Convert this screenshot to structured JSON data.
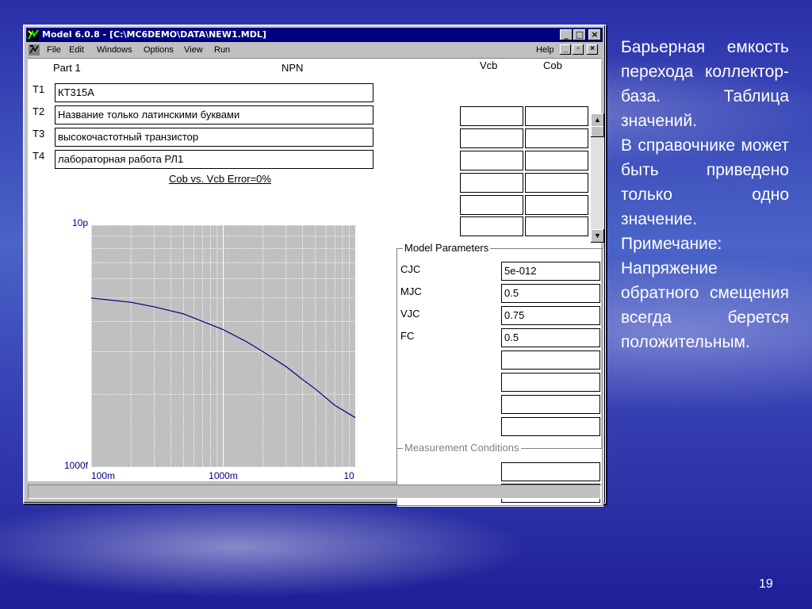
{
  "window": {
    "title": "Model 6.0.8 - [C:\\MC6DEMO\\DATA\\NEW1.MDL]",
    "min_label": "_",
    "max_label": "□",
    "close_label": "×"
  },
  "menu": {
    "items": [
      "File",
      "Edit",
      "Windows",
      "Options",
      "View",
      "Run"
    ],
    "help": "Help"
  },
  "header": {
    "part_label": "Part 1",
    "type_label": "NPN",
    "vcb_header": "Vcb",
    "cob_header": "Cob"
  },
  "texts": [
    {
      "label": "T1",
      "value": "КТ315А"
    },
    {
      "label": "T2",
      "value": "Название только латинскими буквами"
    },
    {
      "label": "T3",
      "value": "высокочастотный транзистор"
    },
    {
      "label": "T4",
      "value": "лабораторная работа РЛ1"
    }
  ],
  "graph_title": "Cob vs. Vcb Error=0%",
  "chart_data": {
    "type": "line",
    "title": "Cob vs. Vcb Error=0%",
    "xscale": "log",
    "yscale": "log",
    "xlim": [
      0.1,
      10
    ],
    "ylim": [
      1e-12,
      1e-11
    ],
    "x_ticks": [
      "100m",
      "1000m",
      "10"
    ],
    "y_ticks": [
      "10p",
      "1000f"
    ],
    "series": [
      {
        "x": [
          0.1,
          0.2,
          0.3,
          0.5,
          0.7,
          1.0,
          1.5,
          2.0,
          3.0,
          4.0,
          5.0,
          7.0,
          10.0
        ],
        "y": [
          5e-12,
          4.8e-12,
          4.6e-12,
          4.3e-12,
          4e-12,
          3.7e-12,
          3.3e-12,
          3e-12,
          2.6e-12,
          2.3e-12,
          2.1e-12,
          1.8e-12,
          1.6e-12
        ]
      }
    ],
    "grid": true,
    "line_color": "#000080",
    "plot_background": "#c0c0c0"
  },
  "model_parameters": {
    "legend": "Model Parameters",
    "params": [
      {
        "name": "CJC",
        "value": "5e-012"
      },
      {
        "name": "MJC",
        "value": "0.5"
      },
      {
        "name": "VJC",
        "value": "0.75"
      },
      {
        "name": "FC",
        "value": "0.5"
      }
    ]
  },
  "measurement_conditions": {
    "legend": "Measurement Conditions"
  },
  "slide": {
    "paragraphs": [
      "Барьерная емкость перехода коллектор-база. Таблица значений.",
      "В справочнике может быть приведено только одно значение.",
      "Примечание: Напряжение обратного смещения всегда берется положительным."
    ],
    "page_number": "19"
  },
  "colors": {
    "title_bar": "#000080",
    "window_face": "#c0c0c0",
    "slide_text": "#ffffff"
  }
}
